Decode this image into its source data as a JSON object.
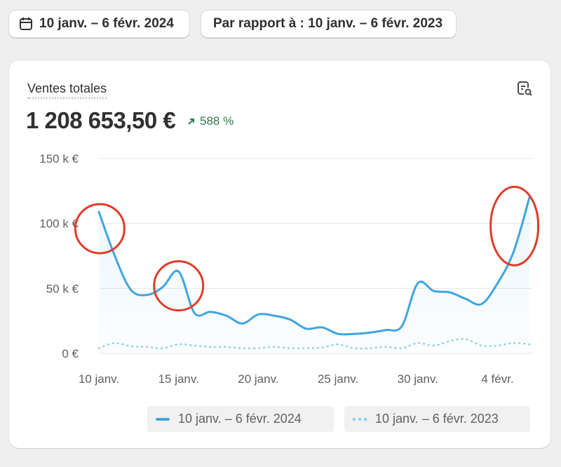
{
  "filters": {
    "date_range": "10 janv. – 6 févr. 2024",
    "compare_range": "Par rapport à : 10 janv. – 6 févr. 2023"
  },
  "card": {
    "title": "Ventes totales",
    "total": "1 208 653,50 €",
    "change": "588 %"
  },
  "colors": {
    "current": "#3ea6dd",
    "previous": "#8fd0f0",
    "annotation": "#e03c2a",
    "change_positive": "#2f7d4f"
  },
  "chart_data": {
    "type": "line",
    "xlabel": "",
    "ylabel": "",
    "ylim": [
      0,
      150000
    ],
    "y_ticks": [
      {
        "value": 0,
        "label": "0 €"
      },
      {
        "value": 50000,
        "label": "50 k €"
      },
      {
        "value": 100000,
        "label": "100 k €"
      },
      {
        "value": 150000,
        "label": "150 k €"
      }
    ],
    "x_ticks": [
      {
        "day": 0,
        "label": "10 janv."
      },
      {
        "day": 5,
        "label": "15 janv."
      },
      {
        "day": 10,
        "label": "20 janv."
      },
      {
        "day": 15,
        "label": "25 janv."
      },
      {
        "day": 20,
        "label": "30 janv."
      },
      {
        "day": 25,
        "label": "4 févr."
      }
    ],
    "grid": true,
    "legend_position": "bottom",
    "series": [
      {
        "name": "10 janv. – 6 févr. 2024",
        "style": "solid",
        "values": [
          109000,
          75000,
          49000,
          45000,
          51000,
          63000,
          31000,
          32000,
          29000,
          23000,
          30000,
          29000,
          26000,
          19000,
          20000,
          15000,
          15000,
          16000,
          18000,
          21000,
          54000,
          48000,
          47000,
          42000,
          38000,
          54000,
          78000,
          120000
        ]
      },
      {
        "name": "10 janv. – 6 févr. 2023",
        "style": "dotted",
        "values": [
          4000,
          8000,
          5500,
          5000,
          4000,
          7000,
          6000,
          5000,
          5000,
          4000,
          4000,
          5000,
          4000,
          4000,
          4500,
          7000,
          4000,
          4000,
          5000,
          4000,
          8000,
          6000,
          9500,
          11000,
          6000,
          6000,
          8000,
          7000
        ]
      }
    ],
    "annotations": [
      {
        "type": "circle",
        "day": 0.5,
        "value": 96000
      },
      {
        "type": "circle",
        "day": 5,
        "value": 52000
      },
      {
        "type": "circle",
        "day": 26.5,
        "value": 98000
      }
    ]
  }
}
